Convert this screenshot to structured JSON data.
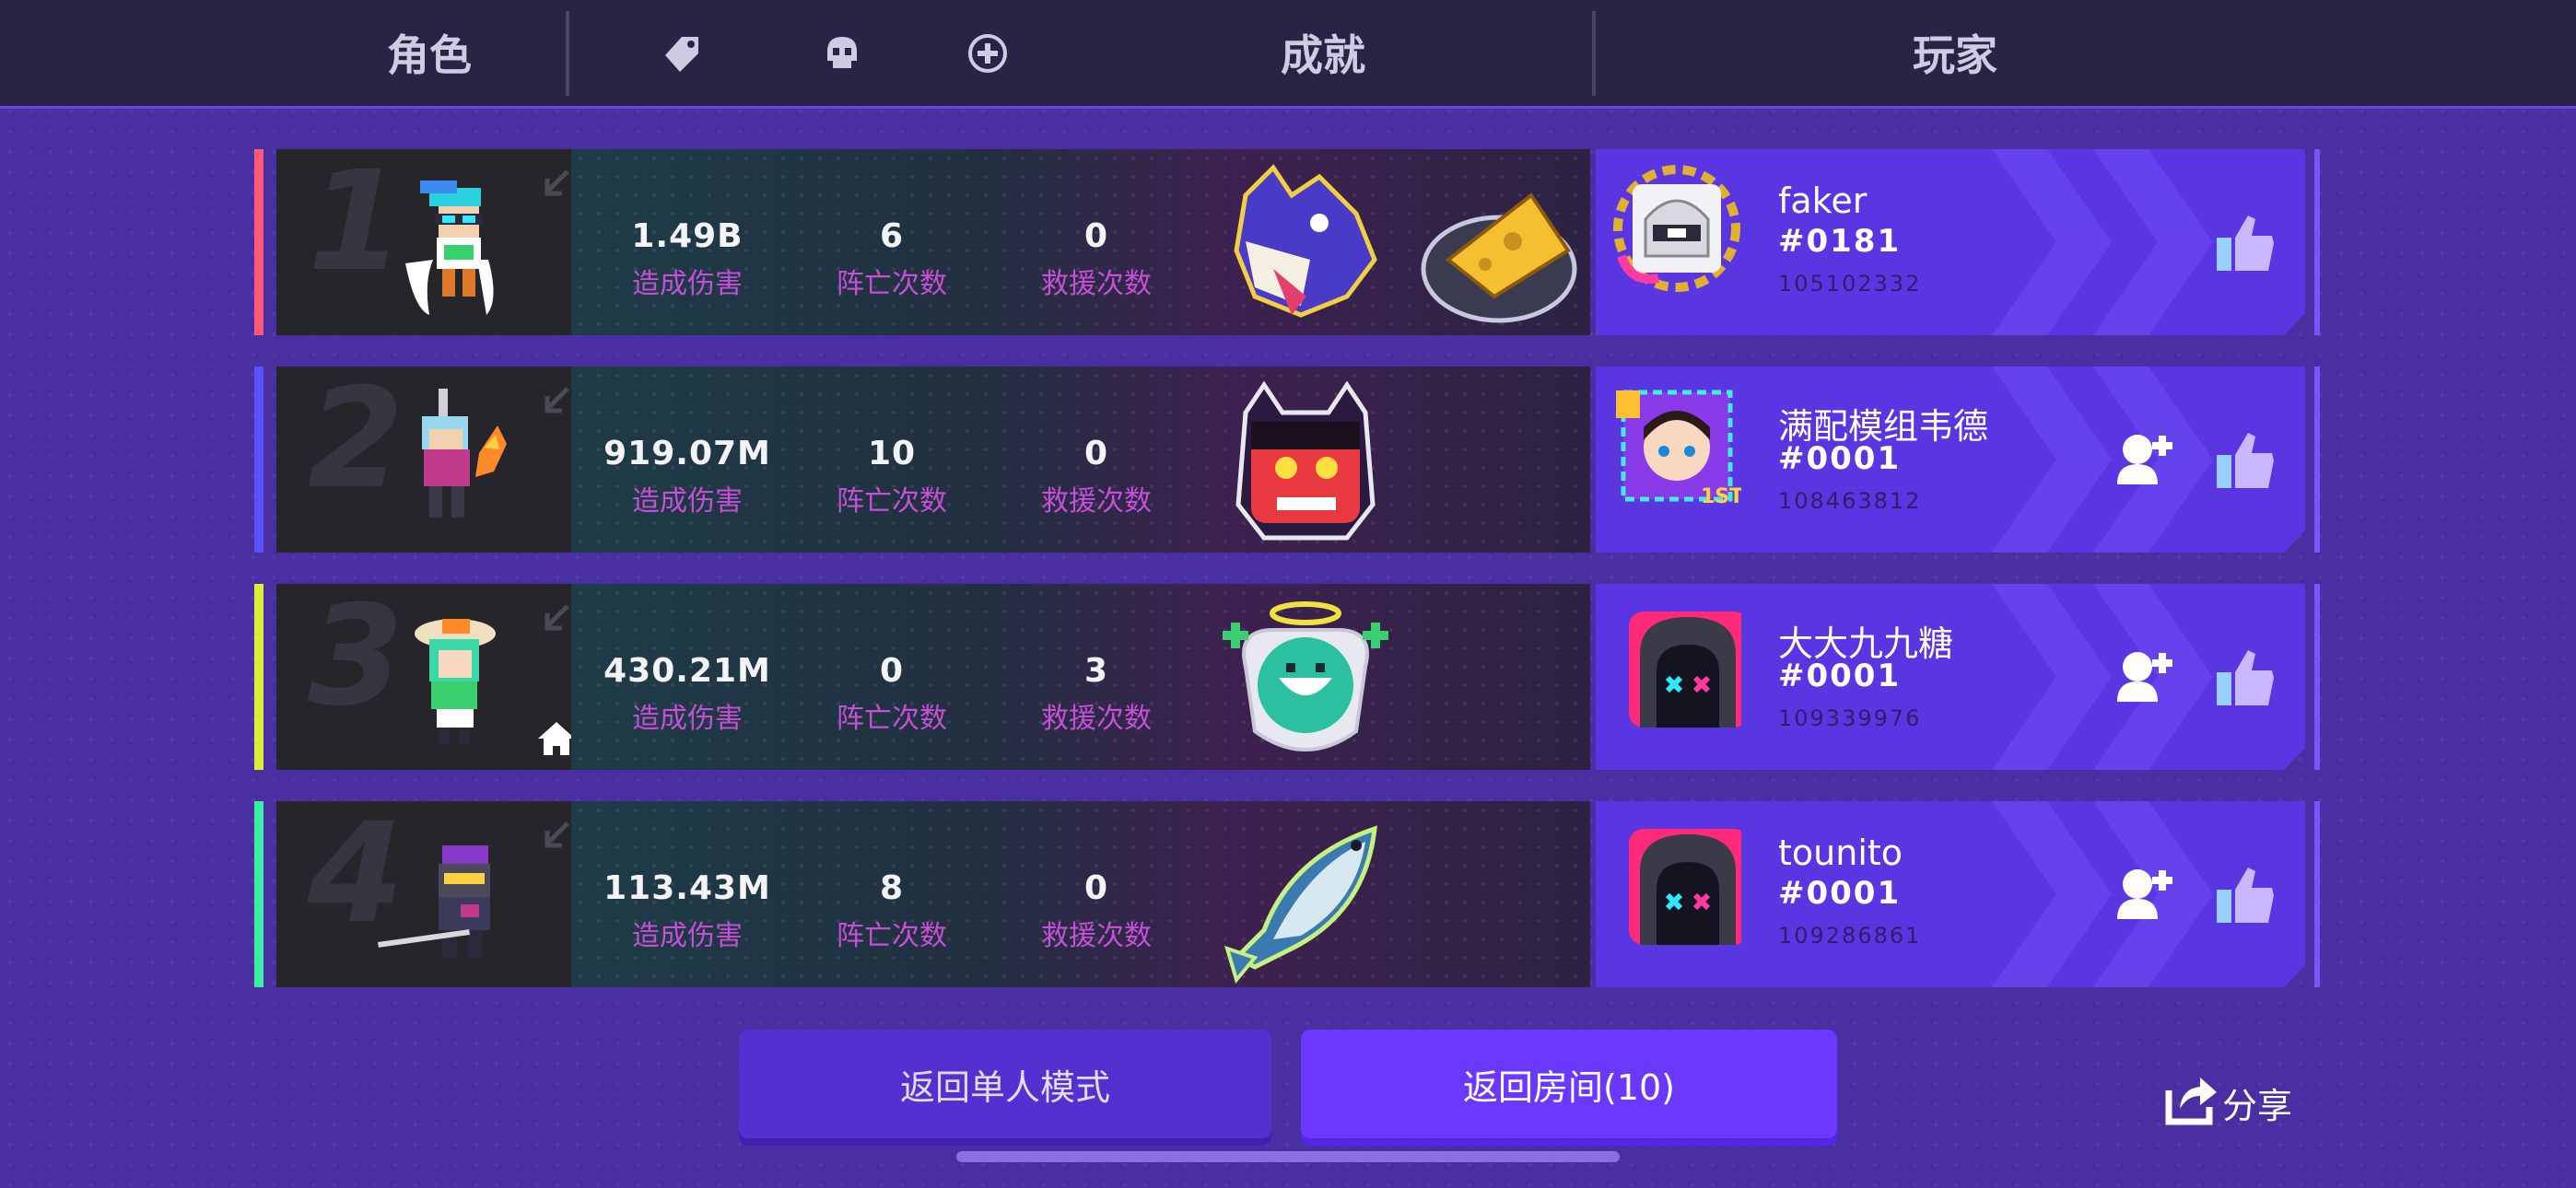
{
  "header": {
    "col_role": "角色",
    "col_achievement": "成就",
    "col_player": "玩家",
    "icons": [
      "tag-icon",
      "skull-icon",
      "plus-circle-icon"
    ]
  },
  "rows": [
    {
      "rank": "1",
      "accent": "#ff5a7a",
      "damage": "1.49B",
      "damage_label": "造成伤害",
      "deaths": "6",
      "deaths_label": "阵亡次数",
      "rescues": "0",
      "rescues_label": "救援次数",
      "player_name": "faker",
      "player_tag": "#0181",
      "player_id": "105102332",
      "achievements": [
        "wolf-badge",
        "cheese-badge"
      ]
    },
    {
      "rank": "2",
      "accent": "#5a50ff",
      "damage": "919.07M",
      "damage_label": "造成伤害",
      "deaths": "10",
      "deaths_label": "阵亡次数",
      "rescues": "0",
      "rescues_label": "救援次数",
      "player_name": "满配模组韦德",
      "player_tag": "#0001",
      "player_id": "108463812",
      "achievements": [
        "oni-badge"
      ]
    },
    {
      "rank": "3",
      "accent": "#d8f03a",
      "damage": "430.21M",
      "damage_label": "造成伤害",
      "deaths": "0",
      "deaths_label": "阵亡次数",
      "rescues": "3",
      "rescues_label": "救援次数",
      "player_name": "大大九九糖",
      "player_tag": "#0001",
      "player_id": "109339976",
      "achievements": [
        "angel-badge"
      ]
    },
    {
      "rank": "4",
      "accent": "#3af0a0",
      "damage": "113.43M",
      "damage_label": "造成伤害",
      "deaths": "8",
      "deaths_label": "阵亡次数",
      "rescues": "0",
      "rescues_label": "救援次数",
      "player_name": "tounito",
      "player_tag": "#0001",
      "player_id": "109286861",
      "achievements": [
        "fish-badge"
      ]
    }
  ],
  "buttons": {
    "single_mode": "返回单人模式",
    "room": "返回房间(10)",
    "share": "分享"
  }
}
